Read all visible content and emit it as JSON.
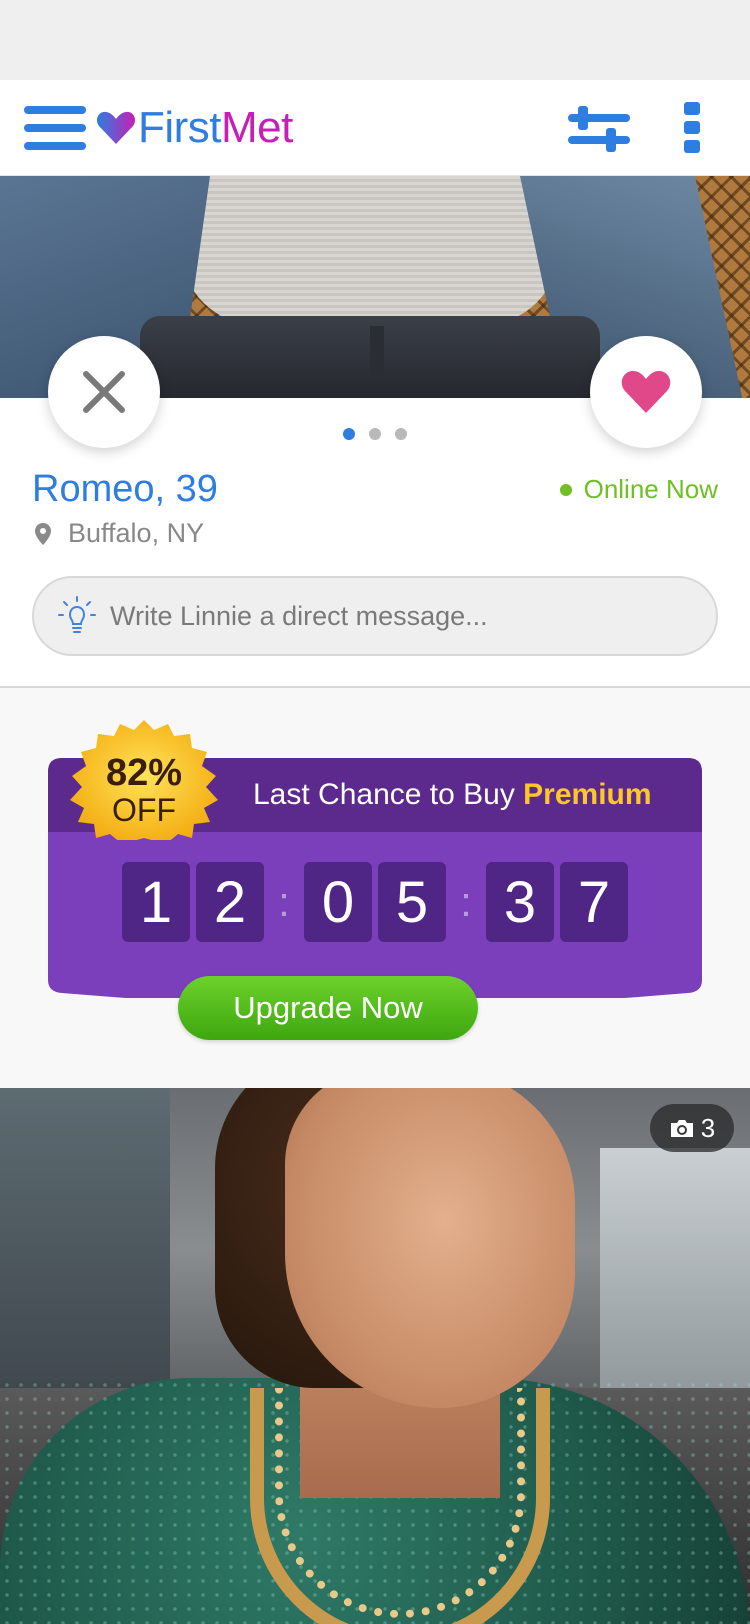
{
  "app": {
    "logo_first": "First",
    "logo_met": "Met"
  },
  "header": {
    "menu_icon": "hamburger-menu-icon",
    "filter_icon": "sliders-filter-icon",
    "more_icon": "vertical-ellipsis-icon"
  },
  "profile": {
    "name_age": "Romeo, 39",
    "status": "Online Now",
    "location": "Buffalo, NY",
    "photo_dots": 3,
    "active_dot": 1,
    "message_placeholder": "Write Linnie a direct message..."
  },
  "promo": {
    "badge_percent": "82%",
    "badge_off": "OFF",
    "title_prefix": "Last Chance to Buy ",
    "title_highlight": "Premium",
    "countdown": {
      "h1": "1",
      "h2": "2",
      "m1": "0",
      "m2": "5",
      "s1": "3",
      "s2": "7"
    },
    "cta": "Upgrade Now"
  },
  "next_profile": {
    "photo_count": "3"
  },
  "colors": {
    "brand_blue": "#2e7de0",
    "brand_magenta": "#c520b5",
    "online_green": "#6ec025",
    "like_pink": "#e0488a",
    "promo_purple": "#7b3fbc",
    "promo_dark_purple": "#5b2a8c",
    "premium_yellow": "#ffc62a",
    "cta_green": "#4cb81a"
  }
}
